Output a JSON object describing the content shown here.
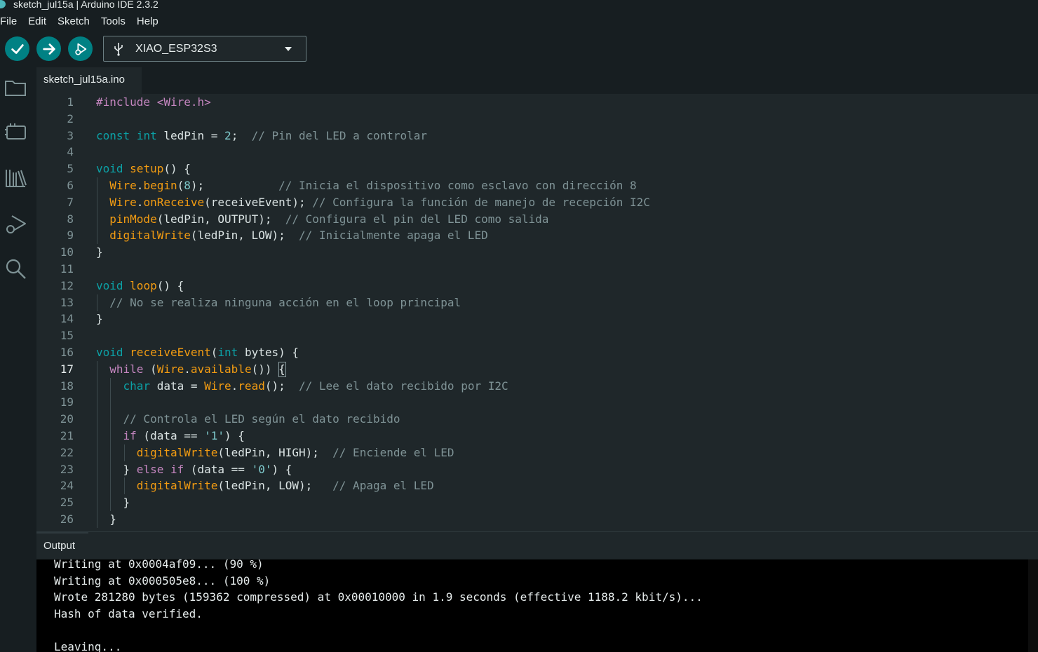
{
  "window": {
    "title": "sketch_jul15a | Arduino IDE 2.3.2"
  },
  "menu": [
    "File",
    "Edit",
    "Sketch",
    "Tools",
    "Help"
  ],
  "toolbar": {
    "verify_icon": "checkmark-icon",
    "upload_icon": "arrow-right-icon",
    "debug_icon": "debug-icon",
    "board_name": "XIAO_ESP32S3"
  },
  "sidebar": {
    "items": [
      "folder-icon",
      "board-icon",
      "library-icon",
      "debug-icon",
      "search-icon"
    ]
  },
  "tabs": [
    {
      "label": "sketch_jul15a.ino",
      "active": true
    }
  ],
  "editor": {
    "active_line": 17,
    "lines": [
      {
        "n": "1",
        "tokens": [
          [
            "pp",
            "#include <Wire.h>"
          ]
        ]
      },
      {
        "n": "2",
        "tokens": []
      },
      {
        "n": "3",
        "tokens": [
          [
            "kw",
            "const"
          ],
          [
            "pl",
            " "
          ],
          [
            "kw",
            "int"
          ],
          [
            "pl",
            " ledPin = "
          ],
          [
            "nm",
            "2"
          ],
          [
            "pl",
            ";  "
          ],
          [
            "cm",
            "// Pin del LED a controlar"
          ]
        ]
      },
      {
        "n": "4",
        "tokens": []
      },
      {
        "n": "5",
        "tokens": [
          [
            "kw",
            "void"
          ],
          [
            "pl",
            " "
          ],
          [
            "fn",
            "setup"
          ],
          [
            "pl",
            "() {"
          ]
        ]
      },
      {
        "n": "6",
        "tokens": [
          [
            "pl",
            "  "
          ],
          [
            "fn",
            "Wire"
          ],
          [
            "pl",
            "."
          ],
          [
            "fn",
            "begin"
          ],
          [
            "pl",
            "("
          ],
          [
            "nm",
            "8"
          ],
          [
            "pl",
            ");           "
          ],
          [
            "cm",
            "// Inicia el dispositivo como esclavo con dirección 8"
          ]
        ]
      },
      {
        "n": "7",
        "tokens": [
          [
            "pl",
            "  "
          ],
          [
            "fn",
            "Wire"
          ],
          [
            "pl",
            "."
          ],
          [
            "fn",
            "onReceive"
          ],
          [
            "pl",
            "(receiveEvent); "
          ],
          [
            "cm",
            "// Configura la función de manejo de recepción I2C"
          ]
        ]
      },
      {
        "n": "8",
        "tokens": [
          [
            "pl",
            "  "
          ],
          [
            "fn",
            "pinMode"
          ],
          [
            "pl",
            "(ledPin, OUTPUT);  "
          ],
          [
            "cm",
            "// Configura el pin del LED como salida"
          ]
        ]
      },
      {
        "n": "9",
        "tokens": [
          [
            "pl",
            "  "
          ],
          [
            "fn",
            "digitalWrite"
          ],
          [
            "pl",
            "(ledPin, LOW);  "
          ],
          [
            "cm",
            "// Inicialmente apaga el LED"
          ]
        ]
      },
      {
        "n": "10",
        "tokens": [
          [
            "pl",
            "}"
          ]
        ]
      },
      {
        "n": "11",
        "tokens": []
      },
      {
        "n": "12",
        "tokens": [
          [
            "kw",
            "void"
          ],
          [
            "pl",
            " "
          ],
          [
            "fn",
            "loop"
          ],
          [
            "pl",
            "() {"
          ]
        ]
      },
      {
        "n": "13",
        "tokens": [
          [
            "pl",
            "  "
          ],
          [
            "cm",
            "// No se realiza ninguna acción en el loop principal"
          ]
        ]
      },
      {
        "n": "14",
        "tokens": [
          [
            "pl",
            "}"
          ]
        ]
      },
      {
        "n": "15",
        "tokens": []
      },
      {
        "n": "16",
        "tokens": [
          [
            "kw",
            "void"
          ],
          [
            "pl",
            " "
          ],
          [
            "fn",
            "receiveEvent"
          ],
          [
            "pl",
            "("
          ],
          [
            "kw",
            "int"
          ],
          [
            "pl",
            " bytes) {"
          ]
        ]
      },
      {
        "n": "17",
        "tokens": [
          [
            "pl",
            "  "
          ],
          [
            "pp",
            "while"
          ],
          [
            "pl",
            " ("
          ],
          [
            "fn",
            "Wire"
          ],
          [
            "pl",
            "."
          ],
          [
            "fn",
            "available"
          ],
          [
            "pl",
            "()) {"
          ]
        ]
      },
      {
        "n": "18",
        "tokens": [
          [
            "pl",
            "    "
          ],
          [
            "kw",
            "char"
          ],
          [
            "pl",
            " data = "
          ],
          [
            "fn",
            "Wire"
          ],
          [
            "pl",
            "."
          ],
          [
            "fn",
            "read"
          ],
          [
            "pl",
            "();  "
          ],
          [
            "cm",
            "// Lee el dato recibido por I2C"
          ]
        ]
      },
      {
        "n": "19",
        "tokens": []
      },
      {
        "n": "20",
        "tokens": [
          [
            "pl",
            "    "
          ],
          [
            "cm",
            "// Controla el LED según el dato recibido"
          ]
        ]
      },
      {
        "n": "21",
        "tokens": [
          [
            "pl",
            "    "
          ],
          [
            "pp",
            "if"
          ],
          [
            "pl",
            " (data == "
          ],
          [
            "st",
            "'1'"
          ],
          [
            "pl",
            ") {"
          ]
        ]
      },
      {
        "n": "22",
        "tokens": [
          [
            "pl",
            "      "
          ],
          [
            "fn",
            "digitalWrite"
          ],
          [
            "pl",
            "(ledPin, HIGH);  "
          ],
          [
            "cm",
            "// Enciende el LED"
          ]
        ]
      },
      {
        "n": "23",
        "tokens": [
          [
            "pl",
            "    } "
          ],
          [
            "pp",
            "else"
          ],
          [
            "pl",
            " "
          ],
          [
            "pp",
            "if"
          ],
          [
            "pl",
            " (data == "
          ],
          [
            "st",
            "'0'"
          ],
          [
            "pl",
            ") {"
          ]
        ]
      },
      {
        "n": "24",
        "tokens": [
          [
            "pl",
            "      "
          ],
          [
            "fn",
            "digitalWrite"
          ],
          [
            "pl",
            "(ledPin, LOW);   "
          ],
          [
            "cm",
            "// Apaga el LED"
          ]
        ]
      },
      {
        "n": "25",
        "tokens": [
          [
            "pl",
            "    }"
          ]
        ]
      },
      {
        "n": "26",
        "tokens": [
          [
            "pl",
            "  }"
          ]
        ]
      }
    ]
  },
  "output": {
    "title": "Output",
    "lines": [
      "Writing at 0x0004af09... (90 %)",
      "Writing at 0x000505e8... (100 %)",
      "Wrote 281280 bytes (159362 compressed) at 0x00010000 in 1.9 seconds (effective 1188.2 kbit/s)...",
      "Hash of data verified.",
      "",
      "Leaving..."
    ]
  }
}
